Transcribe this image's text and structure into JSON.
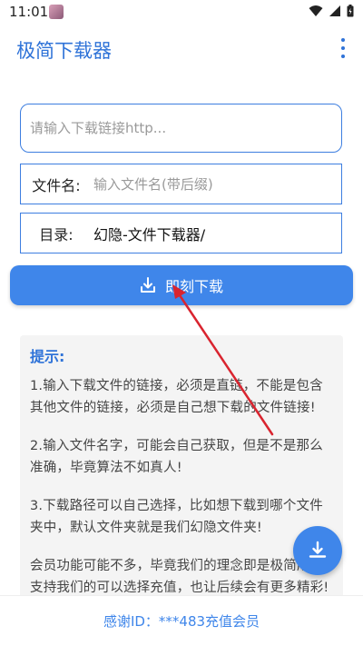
{
  "status_bar": {
    "time": "11:01",
    "icons": [
      "avatar-icon",
      "wifi-icon",
      "signal-icon",
      "battery-icon"
    ]
  },
  "app_bar": {
    "title": "极简下载器",
    "menu_icon": "more-vert-icon"
  },
  "form": {
    "url_placeholder": "请输入下载链接http...",
    "url_value": "",
    "filename_label": "文件名:",
    "filename_placeholder": "输入文件名(带后缀)",
    "filename_value": "",
    "directory_label": "目录:",
    "directory_value": "幻隐-文件下载器/"
  },
  "download_button": {
    "label": "即刻下载",
    "icon": "download-icon"
  },
  "tips": {
    "title": "提示:",
    "paragraphs": [
      "1.输入下载文件的链接，必须是直链，不能是包含其他文件的链接，必须是自己想下载的文件链接!",
      "2.输入文件名字，可能会自己获取，但是不是那么准确，毕竟算法不如真人!",
      "3.下载路径可以自己选择，比如想下载到哪个文件夹中，默认文件夹就是我们幻隐文件夹!",
      "会员功能可能不多，毕竟我们的理念即是极简所以支持我们的可以选择充值，也让后续会有更多精彩!"
    ]
  },
  "fab": {
    "icon": "download-icon"
  },
  "footer": {
    "text": "感谢ID：***483充值会员"
  },
  "colors": {
    "accent": "#3f86ea",
    "title": "#2f73d8",
    "annotation_arrow": "#d9242f"
  }
}
